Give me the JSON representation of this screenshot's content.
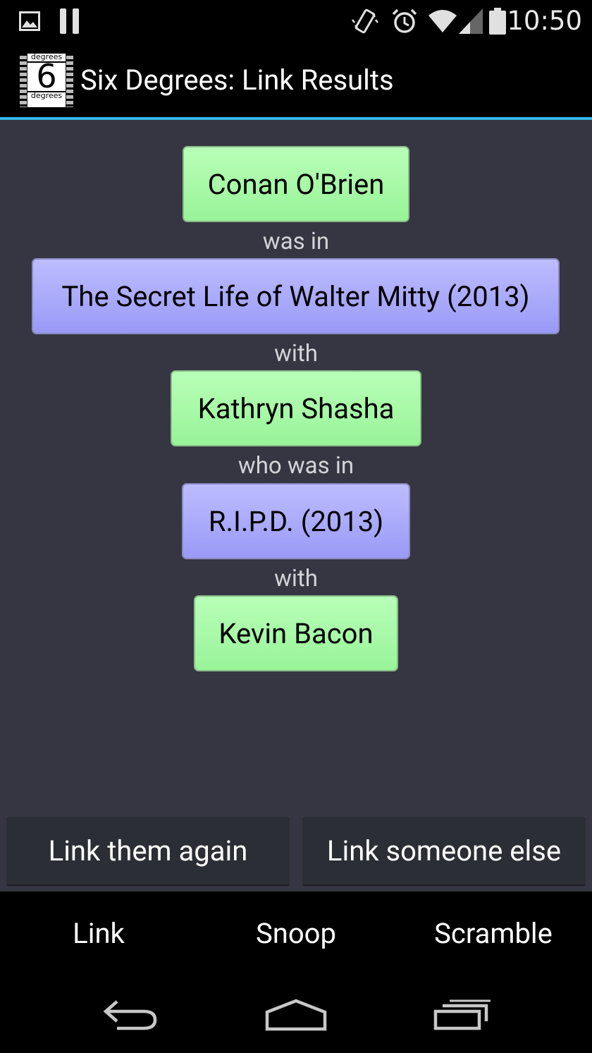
{
  "status_bar": {
    "time": "10:50",
    "icons": [
      "gallery-icon",
      "pause-icon",
      "vibrate-icon",
      "alarm-icon",
      "wifi-icon",
      "signal-icon",
      "battery-icon"
    ]
  },
  "action_bar": {
    "title": "Six Degrees: Link Results",
    "app_icon": {
      "top_label": "degrees",
      "digit": "6",
      "bottom_label": "degrees"
    }
  },
  "chain": {
    "node1": "Conan O'Brien",
    "connector1": "was in",
    "node2": "The Secret Life of Walter Mitty (2013)",
    "connector2": "with",
    "node3": "Kathryn Shasha",
    "connector3": "who was in",
    "node4": "R.I.P.D. (2013)",
    "connector4": "with",
    "node5": "Kevin Bacon"
  },
  "buttons": {
    "link_again": "Link them again",
    "link_else": "Link someone else"
  },
  "tabs": {
    "link": "Link",
    "snoop": "Snoop",
    "scramble": "Scramble"
  },
  "colors": {
    "accent": "#33b5e5",
    "actor_node": "#a6f9a6",
    "movie_node": "#aaaaff",
    "content_bg": "#363642"
  }
}
